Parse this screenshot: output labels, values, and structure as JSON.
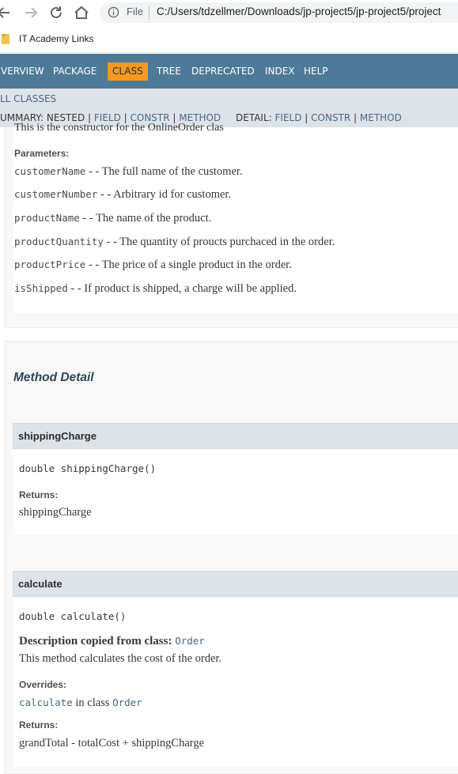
{
  "browser": {
    "address_prefix": "File",
    "url": "C:/Users/tdzellmer/Downloads/jp-project5/jp-project5/project",
    "bookmark_label": "IT Academy Links"
  },
  "nav": {
    "overview": "VERVIEW",
    "package": "PACKAGE",
    "class": "CLASS",
    "tree": "TREE",
    "deprecated": "DEPRECATED",
    "index": "INDEX",
    "help": "HELP",
    "all_classes": "LL CLASSES",
    "summary_prefix": "UMMARY: NESTED | ",
    "summary_field": "FIELD",
    "summary_constr": "CONSTR",
    "summary_method": "METHOD",
    "detail_prefix": "DETAIL: ",
    "detail_field": "FIELD",
    "detail_constr": "CONSTR",
    "detail_method": "METHOD",
    "sep": " | "
  },
  "constructor": {
    "clipped_text": "This is the constructor for the OnlineOrder clas",
    "params_label": "Parameters:",
    "params": [
      {
        "name": "customerName",
        "desc": " - - The full name of the customer."
      },
      {
        "name": "customerNumber",
        "desc": " - - Arbitrary id for customer."
      },
      {
        "name": "productName",
        "desc": " - - The name of the product."
      },
      {
        "name": "productQuantity",
        "desc": " - - The quantity of proucts purchaced in the order."
      },
      {
        "name": "productPrice",
        "desc": " - - The price of a single product in the order."
      },
      {
        "name": "isShipped",
        "desc": " - - If product is shipped, a charge will be applied."
      }
    ]
  },
  "method_detail": {
    "title": "Method Detail",
    "methods": [
      {
        "name": "shippingCharge",
        "signature": "double shippingCharge()",
        "returns_label": "Returns:",
        "returns": "shippingCharge"
      },
      {
        "name": "calculate",
        "signature": "double calculate()",
        "desc_copied_label": "Description copied from class: ",
        "desc_copied_class": "Order",
        "description": "This method calculates the cost of the order.",
        "overrides_label": "Overrides:",
        "overrides_method": "calculate",
        "overrides_in": " in class ",
        "overrides_class": "Order",
        "returns_label": "Returns:",
        "returns": "grandTotal - totalCost + shippingCharge"
      }
    ]
  }
}
